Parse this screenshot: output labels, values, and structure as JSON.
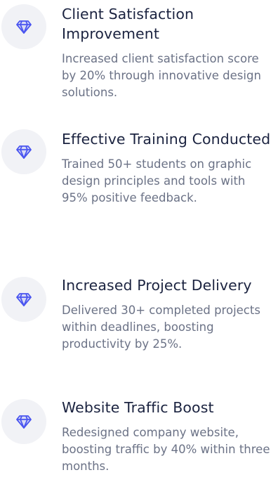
{
  "achievements": [
    {
      "icon": "diamond-icon",
      "title": "Client Satisfaction Improvement",
      "description": "Increased client satisfaction score by 20% through innovative design solutions."
    },
    {
      "icon": "diamond-icon",
      "title": "Effective Training Conducted",
      "description": "Trained 50+ students on graphic design principles and tools with 95% positive feedback."
    },
    {
      "icon": "diamond-icon",
      "title": "Increased Project Delivery",
      "description": "Delivered 30+ completed projects within deadlines, boosting productivity by 25%."
    },
    {
      "icon": "diamond-icon",
      "title": "Website Traffic Boost",
      "description": "Redesigned company website, boosting traffic by 40% within three months."
    }
  ],
  "colors": {
    "icon_accent": "#4a55f0",
    "badge_background": "#f1f2f6",
    "title_text": "#1b2340",
    "description_text": "#6b7286"
  }
}
